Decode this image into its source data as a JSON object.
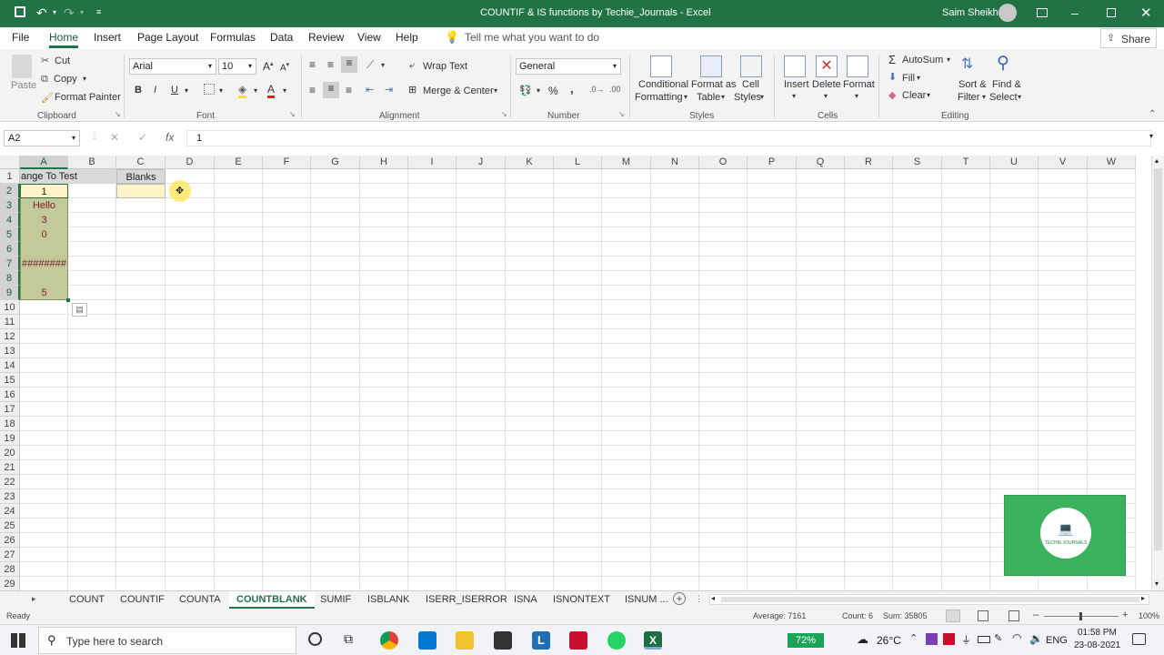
{
  "window": {
    "title": "COUNTIF & IS functions by Techie_Journals",
    "user": "Saim Sheikh"
  },
  "menu": [
    "File",
    "Home",
    "Insert",
    "Page Layout",
    "Formulas",
    "Data",
    "Review",
    "View",
    "Help"
  ],
  "tell_me": "Tell me what you want to do",
  "share": "Share",
  "ribbon": {
    "clipboard": {
      "paste": "Paste",
      "cut": "Cut",
      "copy": "Copy",
      "format_painter": "Format Painter",
      "label": "Clipboard"
    },
    "font": {
      "name": "Arial",
      "size": "10",
      "label": "Font"
    },
    "alignment": {
      "wrap": "Wrap Text",
      "merge": "Merge & Center",
      "label": "Alignment"
    },
    "number": {
      "format": "General",
      "label": "Number"
    },
    "styles": {
      "conditional": "Conditional",
      "formatting": "Formatting",
      "format_as": "Format as",
      "table": "Table",
      "cell": "Cell",
      "cell_styles": "Styles",
      "label": "Styles"
    },
    "cells": {
      "insert": "Insert",
      "delete": "Delete",
      "format": "Format",
      "label": "Cells"
    },
    "editing": {
      "autosum": "AutoSum",
      "fill": "Fill",
      "clear": "Clear",
      "sort": "Sort &",
      "filter": "Filter",
      "find": "Find &",
      "select": "Select",
      "label": "Editing"
    }
  },
  "formula_bar": {
    "name_box": "A2",
    "formula": "1"
  },
  "columns": [
    "A",
    "B",
    "C",
    "D",
    "E",
    "F",
    "G",
    "H",
    "I",
    "J",
    "K",
    "L",
    "M",
    "N",
    "O",
    "P",
    "Q",
    "R",
    "S",
    "T",
    "U",
    "V",
    "W"
  ],
  "rows": [
    "1",
    "2",
    "3",
    "4",
    "5",
    "6",
    "7",
    "8",
    "9",
    "10",
    "11",
    "12",
    "13",
    "14",
    "15",
    "16",
    "17",
    "18",
    "19",
    "20",
    "21",
    "22",
    "23",
    "24",
    "25",
    "26",
    "27",
    "28",
    "29"
  ],
  "cells": {
    "a1": "ange To Test",
    "c1": "Blanks",
    "a2": "1",
    "a3": "Hello",
    "a4": "3",
    "a5": "0",
    "a7": "########",
    "a9": "5"
  },
  "sheet_tabs": [
    "COUNT",
    "COUNTIF",
    "COUNTA",
    "COUNTBLANK",
    "SUMIF",
    "ISBLANK",
    "ISERR_ISERROR",
    "ISNA",
    "ISNONTEXT",
    "ISNUM ..."
  ],
  "status": {
    "ready": "Ready",
    "average": "Average: 7161",
    "count": "Count: 6",
    "sum": "Sum: 35805",
    "zoom": "100%"
  },
  "taskbar": {
    "search": "Type here to search",
    "battery": "72%",
    "temp": "26°C",
    "lang": "ENG",
    "time": "01:58 PM",
    "date": "23-08-2021"
  },
  "watermark": "TECHIE JOURNALS",
  "colors": {
    "excel_green": "#217346",
    "range_fill": "#c4c99a",
    "selected_fill": "#fdf5c8",
    "header_fill": "#d9d9d9",
    "text_maroon": "#7a1f2b"
  }
}
